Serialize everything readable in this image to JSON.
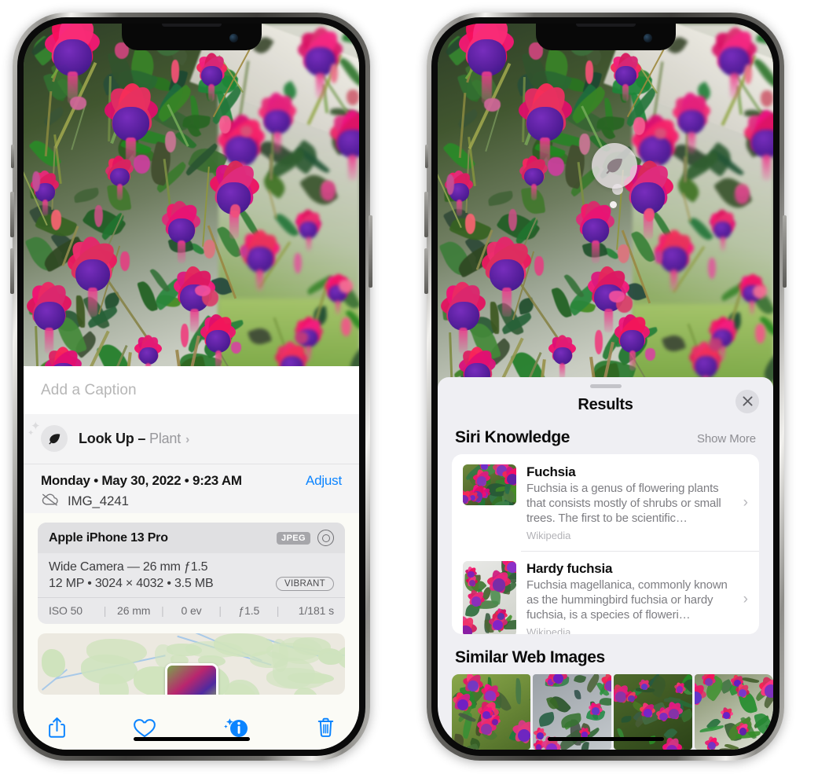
{
  "left_phone": {
    "name": "iphone-photos-info",
    "caption": {
      "placeholder": "Add a Caption"
    },
    "lookup": {
      "icon": "leaf-icon",
      "label": "Look Up",
      "dash": " – ",
      "subject": "Plant",
      "chevron": "›"
    },
    "meta": {
      "date": "Monday • May 30, 2022 • 9:23 AM",
      "adjust_label": "Adjust",
      "cloud_icon": "icloud-slash-icon",
      "filename": "IMG_4241"
    },
    "camera_card": {
      "device": "Apple iPhone 13 Pro",
      "format_badge": "JPEG",
      "aperture_icon": "aperture-icon",
      "lens": "Wide Camera — 26 mm ƒ1.5",
      "resolution": "12 MP • 3024 × 4032 • 3.5 MB",
      "style_badge": "VIBRANT",
      "exif": [
        "ISO 50",
        "26 mm",
        "0 ev",
        "ƒ1.5",
        "1/181 s"
      ]
    },
    "map": {
      "name": "location-map-preview"
    },
    "toolbar": {
      "share": "share-icon",
      "favorite": "heart-icon",
      "info": "info-sparkle-icon",
      "delete": "trash-icon"
    }
  },
  "right_phone": {
    "name": "iphone-visual-look-up-results",
    "badge": {
      "icon": "leaf-icon",
      "label": "visual-look-up-badge"
    },
    "sheet": {
      "title": "Results",
      "close_icon": "close-icon",
      "grabber": "sheet-grabber"
    },
    "siri_knowledge": {
      "header": "Siri Knowledge",
      "show_more": "Show More",
      "items": [
        {
          "title": "Fuchsia",
          "description": "Fuchsia is a genus of flowering plants that consists mostly of shrubs or small trees. The first to be scientific…",
          "source": "Wikipedia",
          "chevron": "›"
        },
        {
          "title": "Hardy fuchsia",
          "description": "Fuchsia magellanica, commonly known as the hummingbird fuchsia or hardy fuchsia, is a species of floweri…",
          "source": "Wikipedia",
          "chevron": "›"
        }
      ]
    },
    "similar_web_images": {
      "header": "Similar Web Images",
      "items": [
        {
          "name": "web-image-1"
        },
        {
          "name": "web-image-2"
        },
        {
          "name": "web-image-3"
        },
        {
          "name": "web-image-4"
        }
      ]
    }
  },
  "colors": {
    "accent_blue": "#0b84ff",
    "sheet_bg": "#efeff3",
    "card_bg": "#ffffff",
    "muted_text": "#8d8d92"
  }
}
